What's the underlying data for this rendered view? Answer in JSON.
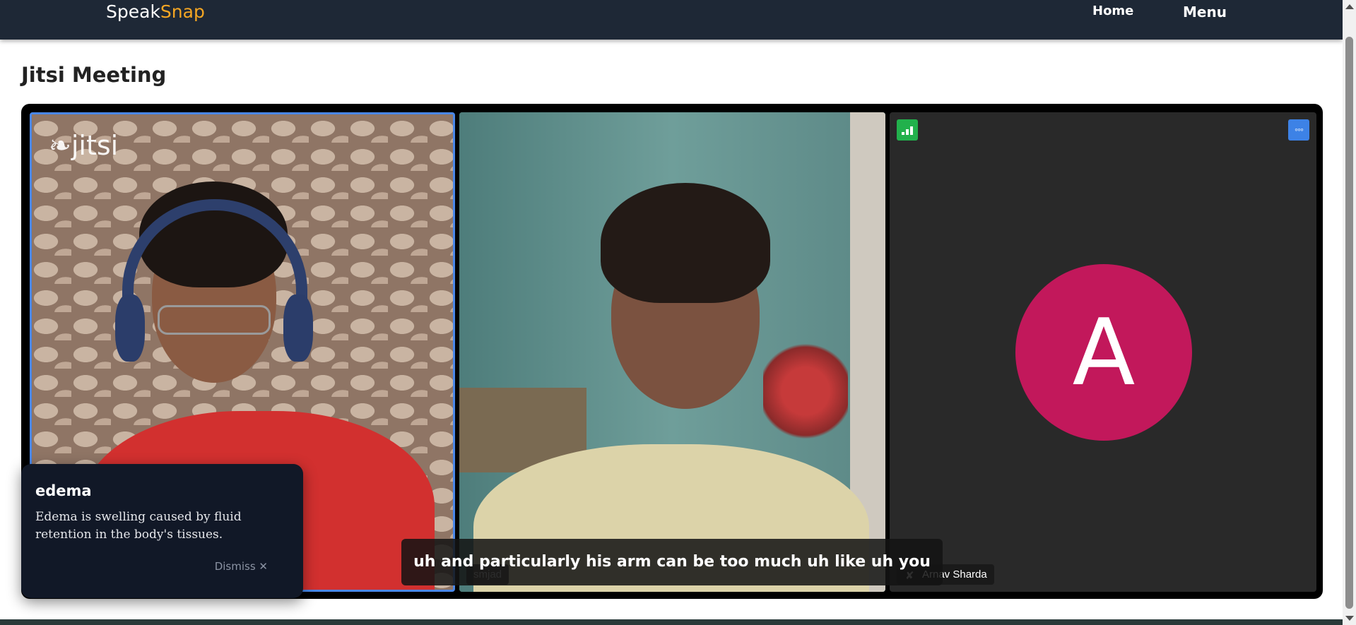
{
  "navbar": {
    "brand_part1": "Speak",
    "brand_part2": "Snap",
    "home_label": "Home",
    "menu_label": "Menu"
  },
  "page": {
    "title": "Jitsi Meeting"
  },
  "meeting": {
    "logo_text": "jitsi",
    "participants": [
      {
        "name": "",
        "video": true,
        "dominant_speaker": true
      },
      {
        "name": "smjad",
        "video": true
      },
      {
        "name": "Arnav Sharda",
        "video": false,
        "avatar_letter": "A",
        "avatar_color": "#c2185b",
        "muted": true
      }
    ],
    "caption": "uh and particularly his arm can be too much uh like uh you can't fix it"
  },
  "popup": {
    "term": "edema",
    "definition": "Edema is swelling caused by fluid retention in the body's tissues.",
    "dismiss_label": "Dismiss",
    "dismiss_icon": "✕"
  },
  "icons": {
    "signal": "signal-bars-icon",
    "more": "more-options-icon",
    "more_glyph": "◦◦◦",
    "mic_muted": "✘"
  },
  "colors": {
    "navbar_bg": "#1e2836",
    "brand_accent": "#f5a623",
    "dominant_border": "#4a87e8",
    "signal_green": "#22b14c",
    "more_blue": "#3d82e6"
  }
}
